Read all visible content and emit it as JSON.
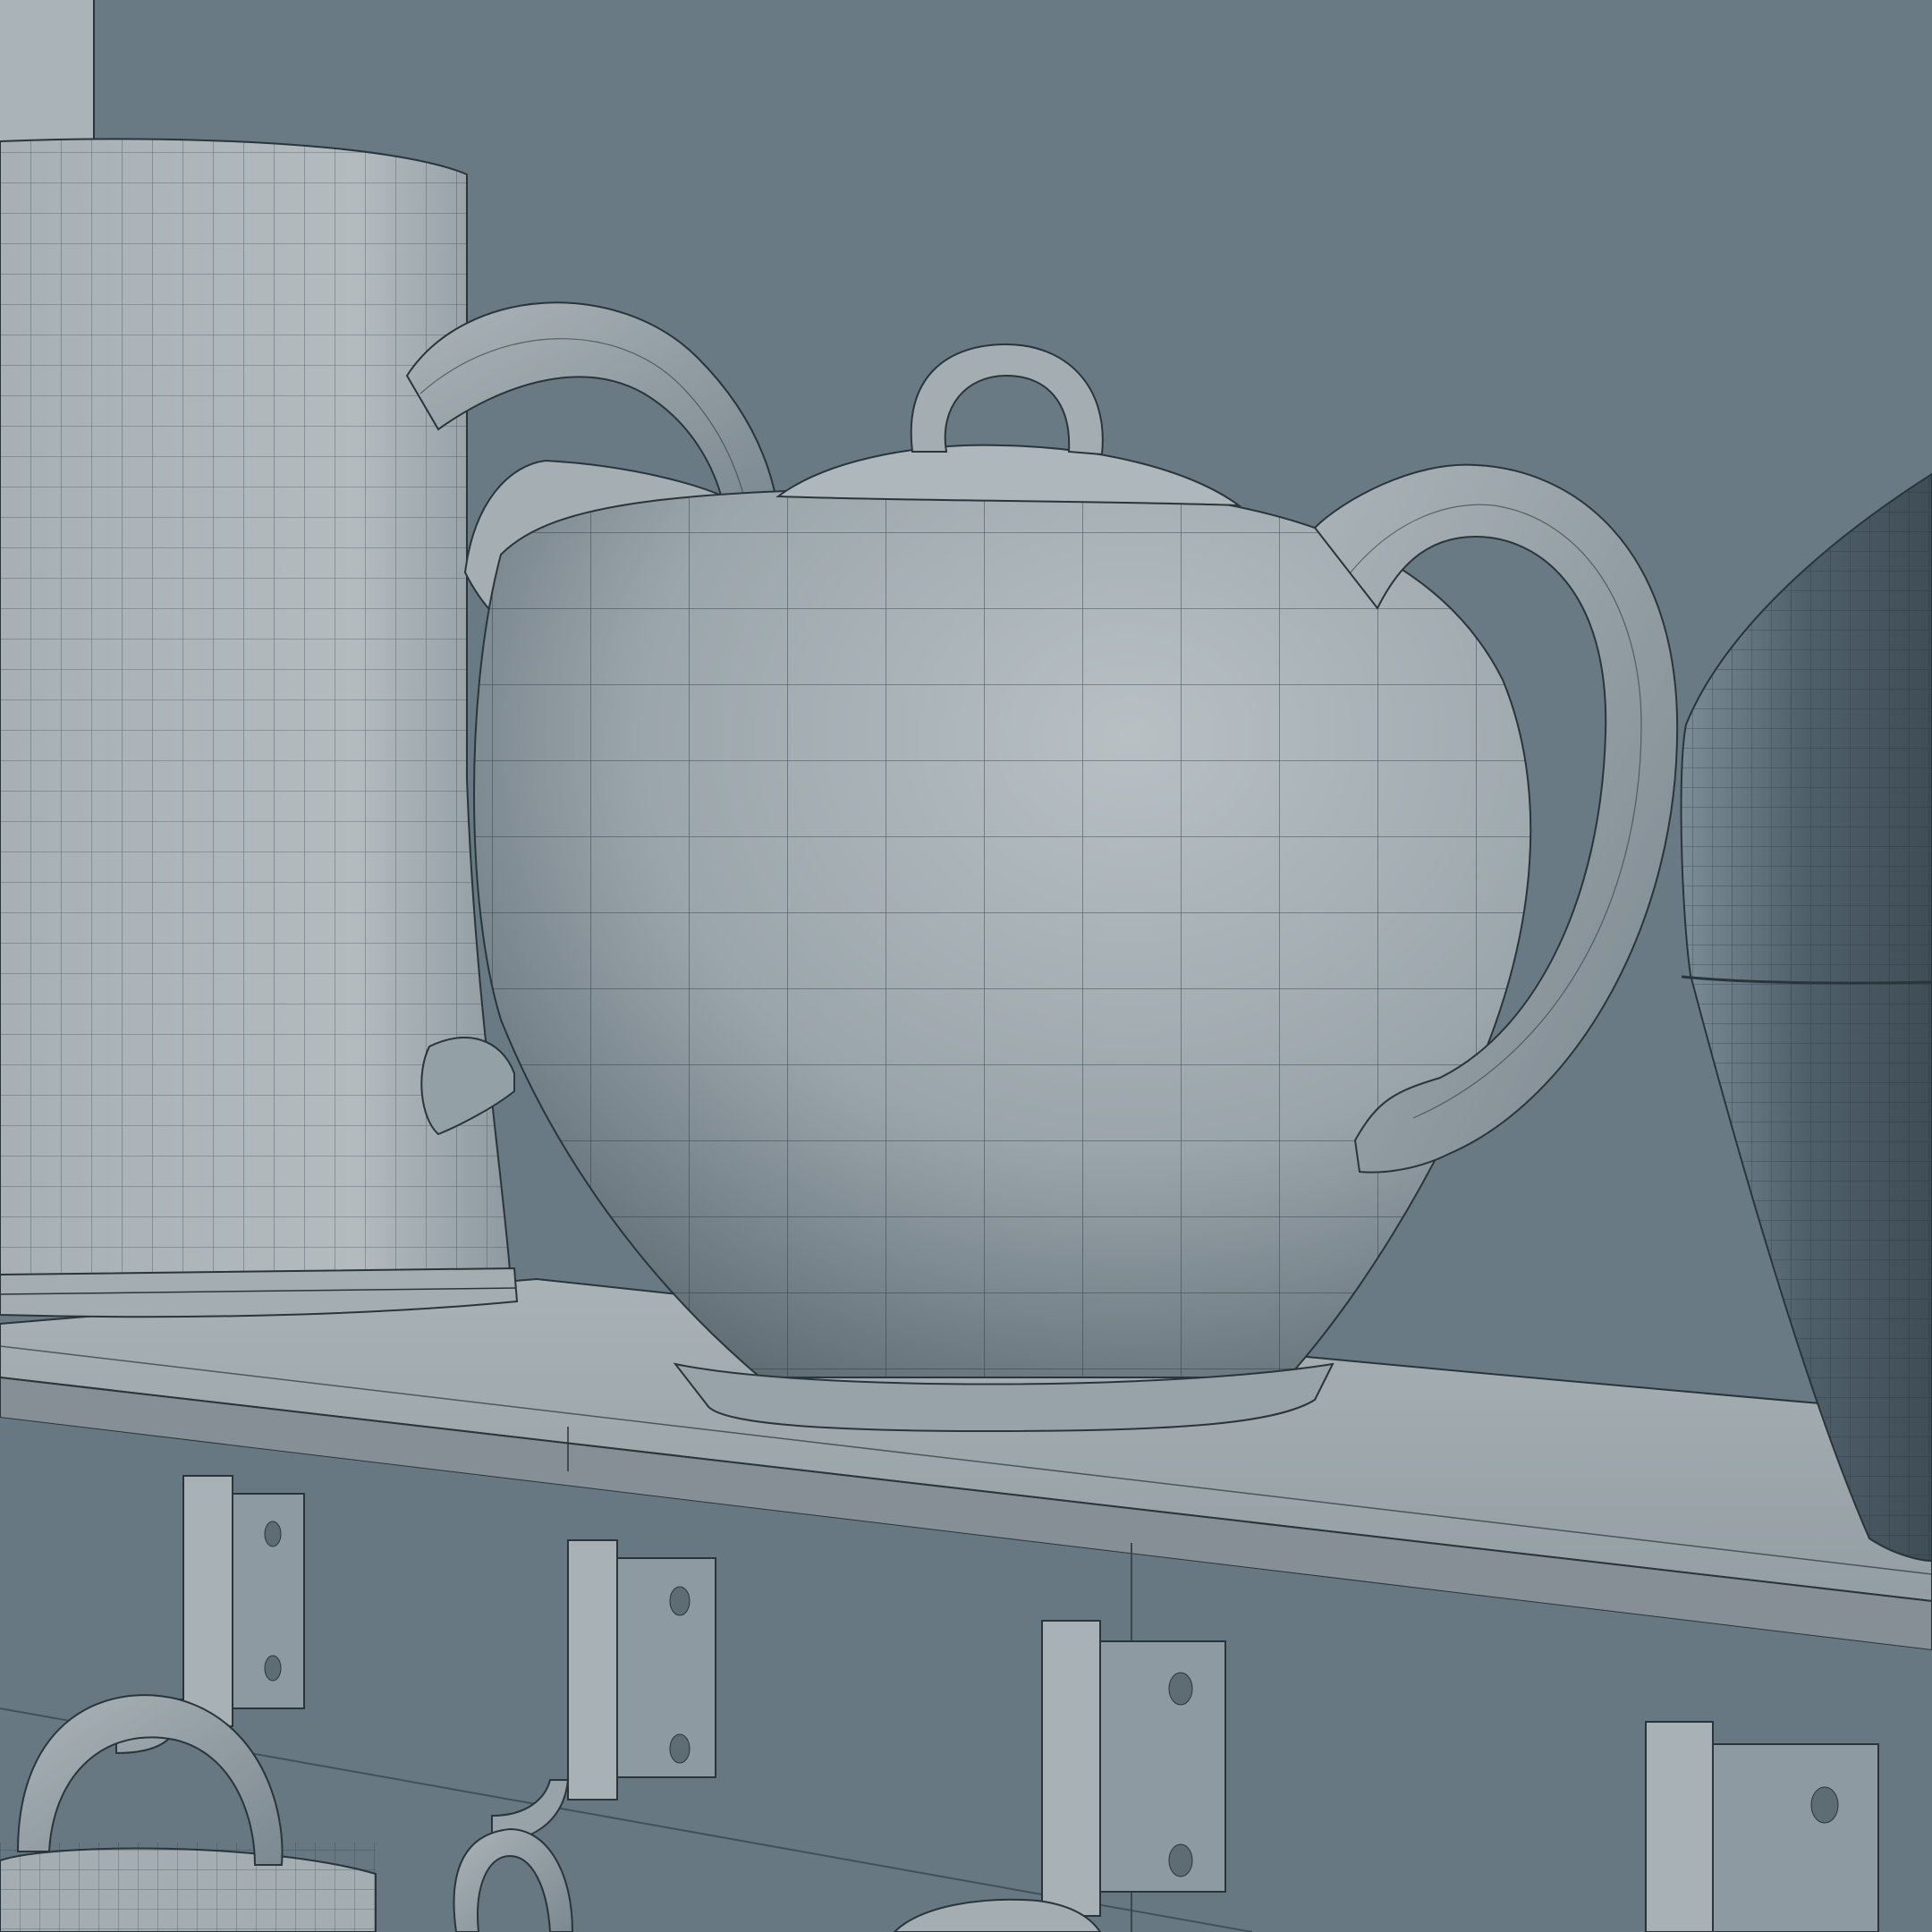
{
  "scene": {
    "kind": "3d-wireframe-render",
    "subjects": [
      "pitcher",
      "teapot",
      "vase",
      "shelf",
      "wall-hooks",
      "mugs"
    ],
    "colors": {
      "background": "#697a84",
      "surface_light": "#b5bdc1",
      "surface_mid": "#949fa6",
      "surface_dark": "#4c5b64",
      "wire": "#1f2a30"
    }
  }
}
